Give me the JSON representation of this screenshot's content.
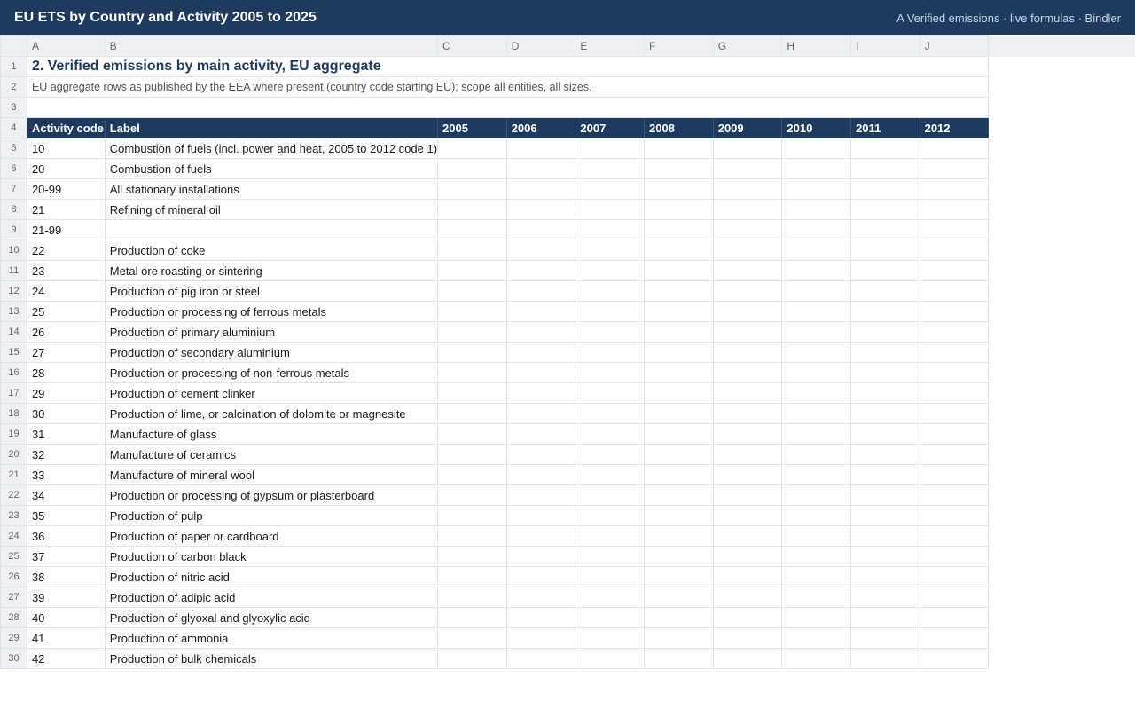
{
  "window": {
    "title": "EU ETS by Country and Activity 2005 to 2025",
    "meta": "A Verified emissions · live formulas · Bindler"
  },
  "columns": [
    "A",
    "B",
    "C",
    "D",
    "E",
    "F",
    "G",
    "H",
    "I",
    "J"
  ],
  "sheet": {
    "title": "2. Verified emissions by main activity, EU aggregate",
    "subtitle": "EU aggregate rows as published by the EEA where present (country code starting EU); scope all entities, all sizes.",
    "headers": [
      "Activity code",
      "Label",
      "2005",
      "2006",
      "2007",
      "2008",
      "2009",
      "2010",
      "2011",
      "2012"
    ],
    "rows": [
      {
        "code": "10",
        "label": "Combustion of fuels (incl. power and heat, 2005 to 2012 code 1)"
      },
      {
        "code": "20",
        "label": "Combustion of fuels"
      },
      {
        "code": "20-99",
        "label": "All stationary installations"
      },
      {
        "code": "21",
        "label": "Refining of mineral oil"
      },
      {
        "code": "21-99",
        "label": ""
      },
      {
        "code": "22",
        "label": "Production of coke"
      },
      {
        "code": "23",
        "label": "Metal ore roasting or sintering"
      },
      {
        "code": "24",
        "label": "Production of pig iron or steel"
      },
      {
        "code": "25",
        "label": "Production or processing of ferrous metals"
      },
      {
        "code": "26",
        "label": "Production of primary aluminium"
      },
      {
        "code": "27",
        "label": "Production of secondary aluminium"
      },
      {
        "code": "28",
        "label": "Production or processing of non-ferrous metals"
      },
      {
        "code": "29",
        "label": "Production of cement clinker"
      },
      {
        "code": "30",
        "label": "Production of lime, or calcination of dolomite or magnesite"
      },
      {
        "code": "31",
        "label": "Manufacture of glass"
      },
      {
        "code": "32",
        "label": "Manufacture of ceramics"
      },
      {
        "code": "33",
        "label": "Manufacture of mineral wool"
      },
      {
        "code": "34",
        "label": "Production or processing of gypsum or plasterboard"
      },
      {
        "code": "35",
        "label": "Production of pulp"
      },
      {
        "code": "36",
        "label": "Production of paper or cardboard"
      },
      {
        "code": "37",
        "label": "Production of carbon black"
      },
      {
        "code": "38",
        "label": "Production of nitric acid"
      },
      {
        "code": "39",
        "label": "Production of adipic acid"
      },
      {
        "code": "40",
        "label": "Production of glyoxal and glyoxylic acid"
      },
      {
        "code": "41",
        "label": "Production of ammonia"
      },
      {
        "code": "42",
        "label": "Production of bulk chemicals"
      }
    ]
  }
}
